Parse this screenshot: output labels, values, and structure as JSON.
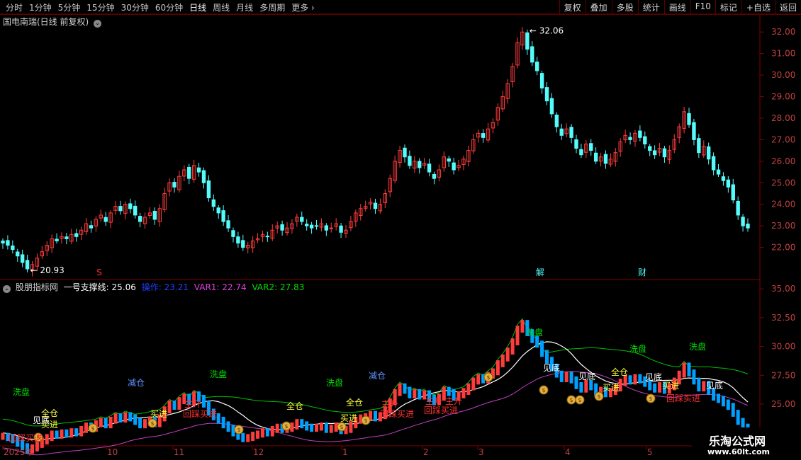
{
  "toolbar": {
    "periods": [
      "分时",
      "1分钟",
      "5分钟",
      "15分钟",
      "30分钟",
      "60分钟",
      "日线",
      "周线",
      "月线",
      "多周期",
      "更多"
    ],
    "active_period": "日线",
    "buttons": [
      "复权",
      "叠加",
      "多股",
      "统计",
      "画线",
      "F10",
      "标记",
      "+自选",
      "返回"
    ]
  },
  "main_chart": {
    "title": "国电南瑞(日线 前复权)",
    "high_label": "32.06",
    "low_label": "20.93",
    "markers": [
      "S",
      "解",
      "财"
    ],
    "y_ticks": [
      "32.00",
      "31.00",
      "30.00",
      "29.00",
      "28.00",
      "27.00",
      "26.00",
      "25.00",
      "24.00",
      "23.00",
      "22.00"
    ]
  },
  "indicator": {
    "name": "股朋指标网",
    "line0_label": "一号支撑线:",
    "line0_value": "25.06",
    "line1_label": "操作:",
    "line1_value": "23.21",
    "line2_label": "VAR1:",
    "line2_value": "22.74",
    "line3_label": "VAR2:",
    "line3_value": "27.83",
    "y_ticks": [
      "35.00",
      "32.50",
      "30.00",
      "27.50",
      "25.00",
      "22.50"
    ],
    "signals": {
      "wash": "洗盘",
      "reduce": "减仓",
      "full": "全仓",
      "buy": "买进",
      "bottom": "见底",
      "main_rise": "主升",
      "pullback_buy": "回踩买进"
    }
  },
  "x_axis": {
    "labels": [
      "2025年",
      "10",
      "11",
      "12",
      "1",
      "2",
      "3",
      "4",
      "5"
    ]
  },
  "watermark": {
    "title": "乐淘公式网",
    "url": "www.60lt.com"
  },
  "colors": {
    "up": "#ff3c3c",
    "down": "#54fcfc",
    "axis": "#800000",
    "support": "#ffffff",
    "var1": "#c040c0",
    "var2": "#00c000",
    "band": "#00a0ff"
  },
  "chart_data": {
    "type": "candlestick",
    "ohlc_closes": [
      22.2,
      22.1,
      21.9,
      21.6,
      21.3,
      21.0,
      21.2,
      21.5,
      21.8,
      22.1,
      22.4,
      22.3,
      22.5,
      22.4,
      22.6,
      22.5,
      22.8,
      23.1,
      22.9,
      23.3,
      23.5,
      23.2,
      23.6,
      23.9,
      23.7,
      24.0,
      23.8,
      23.5,
      23.2,
      23.4,
      23.6,
      23.3,
      23.8,
      24.5,
      25.0,
      24.8,
      25.3,
      25.6,
      25.2,
      25.8,
      25.5,
      25.0,
      24.3,
      23.9,
      23.6,
      23.2,
      22.9,
      22.5,
      22.2,
      22.0,
      22.1,
      22.3,
      22.4,
      22.6,
      22.5,
      22.8,
      23.0,
      22.8,
      22.9,
      23.1,
      23.4,
      23.2,
      23.0,
      22.9,
      23.0,
      23.1,
      22.8,
      22.9,
      23.1,
      22.7,
      22.8,
      23.2,
      23.6,
      23.8,
      23.9,
      24.1,
      23.8,
      24.0,
      24.5,
      25.2,
      26.0,
      26.5,
      26.2,
      25.8,
      26.0,
      25.7,
      25.9,
      25.5,
      25.2,
      25.6,
      26.2,
      26.0,
      25.6,
      25.8,
      26.1,
      26.5,
      27.0,
      27.3,
      27.1,
      27.5,
      27.8,
      28.5,
      29.0,
      29.6,
      30.4,
      31.5,
      32.0,
      31.2,
      30.6,
      30.2,
      29.4,
      28.8,
      28.2,
      27.6,
      27.2,
      27.5,
      27.1,
      26.6,
      26.3,
      26.8,
      26.5,
      26.0,
      26.2,
      25.9,
      26.1,
      26.4,
      26.9,
      27.2,
      27.0,
      27.3,
      27.1,
      26.8,
      26.5,
      26.3,
      26.6,
      26.2,
      26.5,
      27.0,
      27.6,
      28.3,
      27.7,
      27.0,
      26.4,
      26.7,
      26.1,
      25.6,
      25.4,
      25.1,
      24.8,
      24.2,
      23.5,
      23.0,
      22.9
    ],
    "ylim": [
      21,
      32.5
    ],
    "indicator_ylim": [
      21.5,
      35.5
    ],
    "support_last": 25.06,
    "operate_last": 23.21,
    "var1_last": 22.74,
    "var2_last": 27.83
  }
}
